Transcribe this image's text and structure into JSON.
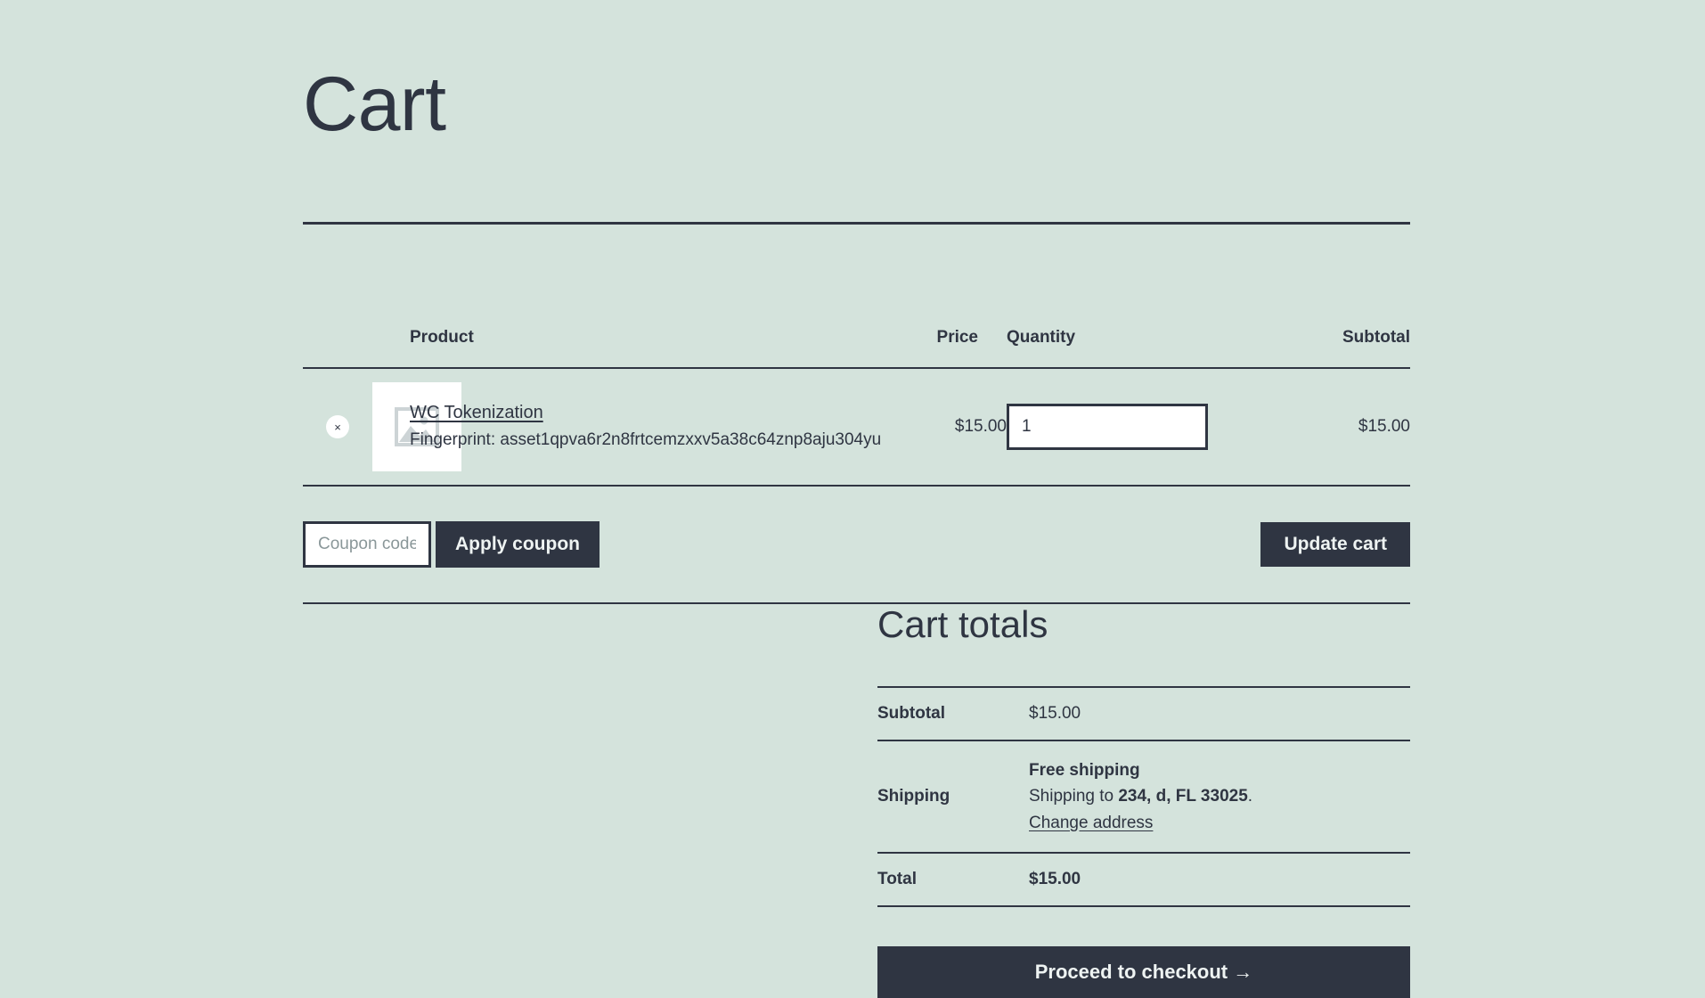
{
  "page": {
    "title": "Cart"
  },
  "cart_table": {
    "headers": {
      "product": "Product",
      "price": "Price",
      "quantity": "Quantity",
      "subtotal": "Subtotal"
    },
    "items": [
      {
        "remove_label": "×",
        "name": "WC Tokenization",
        "meta": "Fingerprint: asset1qpva6r2n8frtcemzxxv5a38c64znp8aju304yu",
        "price": "$15.00",
        "quantity": "1",
        "subtotal": "$15.00"
      }
    ]
  },
  "coupon": {
    "placeholder": "Coupon code",
    "value": "",
    "apply_label": "Apply coupon"
  },
  "actions": {
    "update_label": "Update cart"
  },
  "totals": {
    "heading": "Cart totals",
    "subtotal_label": "Subtotal",
    "subtotal_value": "$15.00",
    "shipping_label": "Shipping",
    "shipping_method": "Free shipping",
    "shipping_to_prefix": "Shipping to ",
    "shipping_address": "234, d, FL 33025",
    "shipping_to_suffix": ".",
    "change_address_label": "Change address",
    "total_label": "Total",
    "total_value": "$15.00",
    "checkout_label": "Proceed to checkout →"
  },
  "colors": {
    "background": "#d4e3dc",
    "ink": "#2f3542",
    "button_text": "#eef3f2",
    "placeholder": "#8a9799"
  }
}
